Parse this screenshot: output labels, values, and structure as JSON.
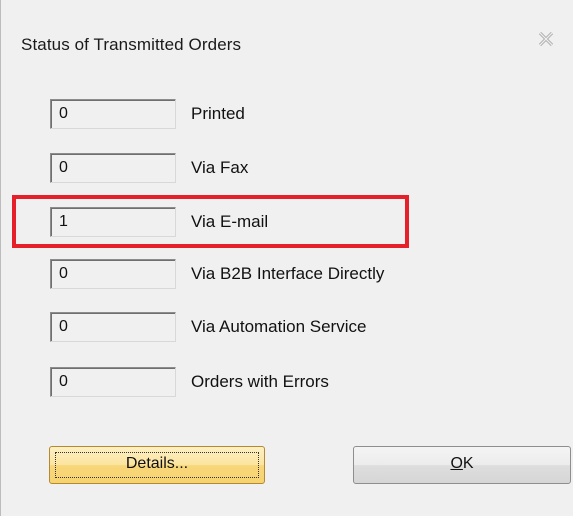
{
  "dialog": {
    "title": "Status of Transmitted Orders",
    "close_icon": "close-icon"
  },
  "rows": [
    {
      "count": "0",
      "label": "Printed"
    },
    {
      "count": "0",
      "label": "Via Fax"
    },
    {
      "count": "1",
      "label": "Via E-mail"
    },
    {
      "count": "0",
      "label": "Via B2B Interface Directly"
    },
    {
      "count": "0",
      "label": "Via Automation Service"
    },
    {
      "count": "0",
      "label": "Orders with Errors"
    }
  ],
  "buttons": {
    "details_label": "Details...",
    "ok_label": "OK"
  },
  "colors": {
    "highlight": "#e5202a",
    "details_button": "#f8d77a"
  }
}
